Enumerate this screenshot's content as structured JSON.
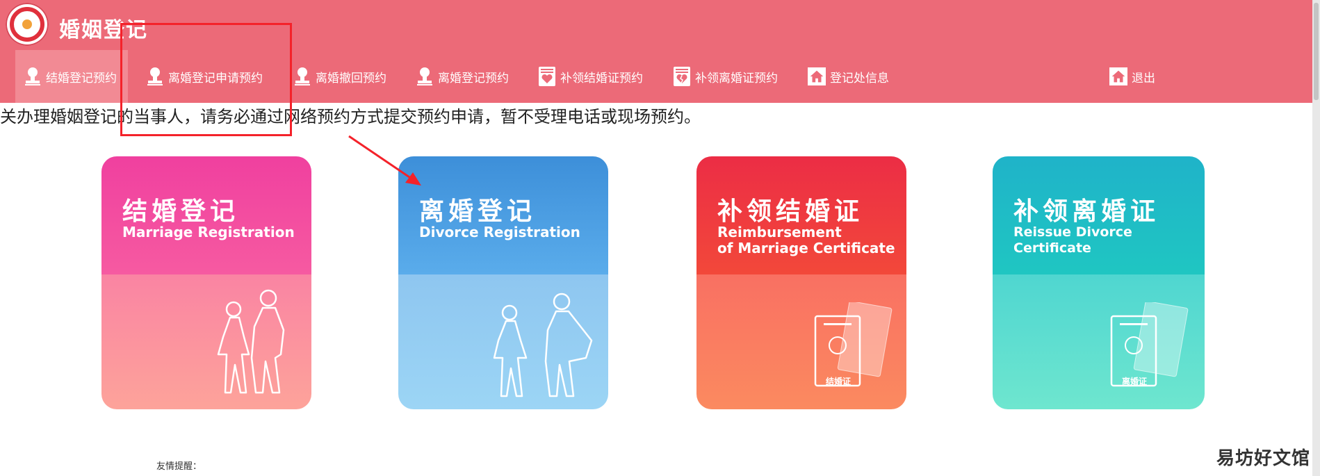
{
  "header": {
    "title": "婚姻登记",
    "logo": "marriage-registration-logo"
  },
  "nav": {
    "items": [
      {
        "label": "结婚登记预约",
        "icon": "stamp-icon",
        "active": true
      },
      {
        "label": "离婚登记申请预约",
        "icon": "stamp-icon"
      },
      {
        "label": "离婚撤回预约",
        "icon": "stamp-icon"
      },
      {
        "label": "离婚登记预约",
        "icon": "stamp-icon"
      },
      {
        "label": "补领结婚证预约",
        "icon": "certificate-heart-icon"
      },
      {
        "label": "补领离婚证预约",
        "icon": "certificate-broken-heart-icon"
      },
      {
        "label": "登记处信息",
        "icon": "home-icon"
      }
    ],
    "logout_label": "退出"
  },
  "notice": "关办理婚姻登记的当事人，请务必通过网络预约方式提交预约申请，暂不受理电话或现场预约。",
  "cards": [
    {
      "cn": "结婚登记",
      "en": "Marriage Registration",
      "colors": {
        "top": "#f0409f",
        "bottom": "#fda39a"
      }
    },
    {
      "cn": "离婚登记",
      "en": "Divorce Registration",
      "colors": {
        "top": "#3d8fd9",
        "bottom": "#9cd5f5"
      }
    },
    {
      "cn": "补领结婚证",
      "en_line1": "Reimbursement",
      "en_line2": "of Marriage Certificate",
      "cert_label": "结婚证",
      "colors": {
        "top": "#ec2d45",
        "bottom": "#fb8a60"
      }
    },
    {
      "cn": "补领离婚证",
      "en": "Reissue Divorce Certificate",
      "cert_label": "离婚证",
      "colors": {
        "top": "#1fb3c9",
        "bottom": "#6ee6cf"
      }
    }
  ],
  "reminder": "友情提醒：",
  "watermark": "易坊好文馆",
  "annotation_color": "#f4222a"
}
